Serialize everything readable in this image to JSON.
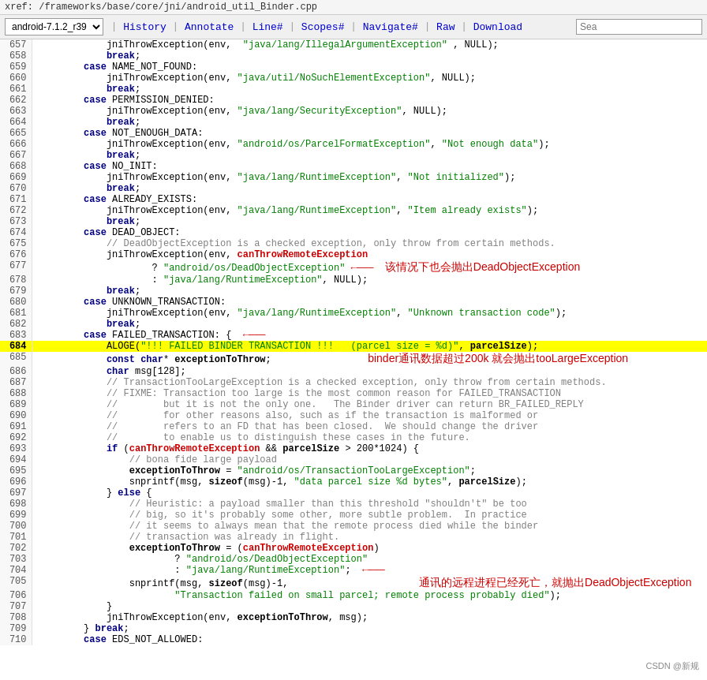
{
  "topbar": {
    "breadcrumb": "xref: /frameworks/base/core/jni/android_util_Binder.cpp"
  },
  "navbar": {
    "version_label": "android-7.1.2_r39",
    "versions": [
      "android-7.1.2_r39"
    ],
    "links": [
      "History",
      "Annotate",
      "Line#",
      "Scopes#",
      "Navigate#",
      "Raw",
      "Download"
    ],
    "search_placeholder": "Sea"
  },
  "lines": [
    {
      "num": "657",
      "code": "            jniThrowException(env,  java/lang/IllegalArgumentException , NULL);"
    },
    {
      "num": "658",
      "code": "            break;"
    },
    {
      "num": "659",
      "code": "        case NAME_NOT_FOUND:",
      "highlight": false
    },
    {
      "num": "660",
      "code": "            jniThrowException(env, \"java/util/NoSuchElementException\", NULL);"
    },
    {
      "num": "661",
      "code": "            break;"
    },
    {
      "num": "662",
      "code": "        case PERMISSION_DENIED:"
    },
    {
      "num": "663",
      "code": "            jniThrowException(env, \"java/lang/SecurityException\", NULL);"
    },
    {
      "num": "664",
      "code": "            break;"
    },
    {
      "num": "665",
      "code": "        case NOT_ENOUGH_DATA:"
    },
    {
      "num": "666",
      "code": "            jniThrowException(env, \"android/os/ParcelFormatException\", \"Not enough data\");"
    },
    {
      "num": "667",
      "code": "            break;"
    },
    {
      "num": "668",
      "code": "        case NO_INIT:"
    },
    {
      "num": "669",
      "code": "            jniThrowException(env, \"java/lang/RuntimeException\", \"Not initialized\");"
    },
    {
      "num": "670",
      "code": "            break;"
    },
    {
      "num": "671",
      "code": "        case ALREADY_EXISTS:"
    },
    {
      "num": "672",
      "code": "            jniThrowException(env, \"java/lang/RuntimeException\", \"Item already exists\");"
    },
    {
      "num": "673",
      "code": "            break;"
    },
    {
      "num": "674",
      "code": "        case DEAD_OBJECT:"
    },
    {
      "num": "675",
      "code": "            // DeadObjectException is a checked exception, only throw from certain methods."
    },
    {
      "num": "676",
      "code": "            jniThrowException(env, canThrowRemoteException"
    },
    {
      "num": "677",
      "code": "                    ? \"android/os/DeadObjectException\""
    },
    {
      "num": "678",
      "code": "                    : \"java/lang/RuntimeException\", NULL);"
    },
    {
      "num": "679",
      "code": "            break;"
    },
    {
      "num": "680",
      "code": "        case UNKNOWN_TRANSACTION:"
    },
    {
      "num": "681",
      "code": "            jniThrowException(env, \"java/lang/RuntimeException\", \"Unknown transaction code\");"
    },
    {
      "num": "682",
      "code": "            break;"
    },
    {
      "num": "683",
      "code": "        case FAILED_TRANSACTION: {"
    },
    {
      "num": "684",
      "code": "            ALOGE(\"!!! FAILED BINDER TRANSACTION !!!   (parcel size = %d)\", parcelSize);",
      "highlight": true
    },
    {
      "num": "685",
      "code": "            const char* exceptionToThrow;"
    },
    {
      "num": "686",
      "code": "            char msg[128];"
    },
    {
      "num": "687",
      "code": "            // TransactionTooLargeException is a checked exception, only throw from certain methods."
    },
    {
      "num": "688",
      "code": "            // FIXME: Transaction too large is the most common reason for FAILED_TRANSACTION"
    },
    {
      "num": "689",
      "code": "            //        but it is not the only one.   The Binder driver can return BR_FAILED_REPLY"
    },
    {
      "num": "690",
      "code": "            //        for other reasons also, such as if the transaction is malformed or"
    },
    {
      "num": "691",
      "code": "            //        refers to an FD that has been closed.  We should change the driver"
    },
    {
      "num": "692",
      "code": "            //        to enable us to distinguish these cases in the future."
    },
    {
      "num": "693",
      "code": "            if (canThrowRemoteException && parcelSize > 200*1024) {"
    },
    {
      "num": "694",
      "code": "                // bona fide large payload"
    },
    {
      "num": "695",
      "code": "                exceptionToThrow = \"android/os/TransactionTooLargeException\";"
    },
    {
      "num": "696",
      "code": "                snprintf(msg, sizeof(msg)-1, \"data parcel size %d bytes\", parcelSize);"
    },
    {
      "num": "697",
      "code": "            } else {"
    },
    {
      "num": "698",
      "code": "                // Heuristic: a payload smaller than this threshold \"shouldn't\" be too"
    },
    {
      "num": "699",
      "code": "                // big, so it's probably some other, more subtle problem.  In practice"
    },
    {
      "num": "700",
      "code": "                // it seems to always mean that the remote process died while the binder"
    },
    {
      "num": "701",
      "code": "                // transaction was already in flight."
    },
    {
      "num": "702",
      "code": "                exceptionToThrow = (canThrowRemoteException)"
    },
    {
      "num": "703",
      "code": "                        ? \"android/os/DeadObjectException\""
    },
    {
      "num": "704",
      "code": "                        : \"java/lang/RuntimeException\";"
    },
    {
      "num": "705",
      "code": "                snprintf(msg, sizeof(msg)-1,"
    },
    {
      "num": "706",
      "code": "                        \"Transaction failed on small parcel; remote process probably died\");"
    },
    {
      "num": "707",
      "code": "            }"
    },
    {
      "num": "708",
      "code": "            jniThrowException(env, exceptionToThrow, msg);"
    },
    {
      "num": "709",
      "code": "        } break;"
    },
    {
      "num": "710",
      "code": "        case EDS_NOT_ALLOWED:"
    }
  ],
  "annotations": {
    "line677": "该情况下也会抛出DeadObjectException",
    "line685": "binder通讯数据超过200k 就会抛出tooLargeException",
    "line704": "通讯的远程进程已经死亡，就抛出DeadObjectException",
    "watermark": "CSDN @新规"
  }
}
